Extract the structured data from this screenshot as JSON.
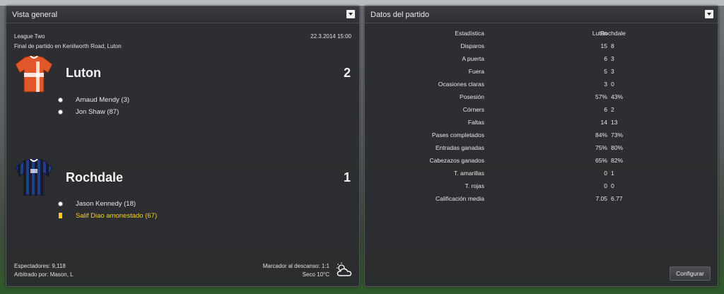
{
  "overview": {
    "title": "Vista general",
    "competition": "League Two",
    "datetime": "22.3.2014 15:00",
    "venue": "Final de partido en Kenilworth Road, Luton",
    "home": {
      "name": "Luton",
      "score": "2",
      "events": [
        {
          "type": "goal",
          "text": "Arnaud Mendy (3)"
        },
        {
          "type": "goal",
          "text": "Jon Shaw (87)"
        }
      ]
    },
    "away": {
      "name": "Rochdale",
      "score": "1",
      "events": [
        {
          "type": "goal",
          "text": "Jason Kennedy (18)"
        },
        {
          "type": "yellow-card",
          "text": "Salif Diao amonestado (67)"
        }
      ]
    },
    "attendance": "Espectadores: 9,118",
    "referee": "Arbitrado por: Mason, L",
    "halftime": "Marcador al descanso: 1:1",
    "weather": "Seco 10°C"
  },
  "stats": {
    "title": "Datos del partido",
    "header": {
      "label": "Estadística",
      "home": "Luton",
      "away": "Rochdale"
    },
    "rows": [
      {
        "label": "Disparos",
        "home": "15",
        "away": "8"
      },
      {
        "label": "A puerta",
        "home": "6",
        "away": "3"
      },
      {
        "label": "Fuera",
        "home": "5",
        "away": "3"
      },
      {
        "label": "Ocasiones claras",
        "home": "3",
        "away": "0"
      },
      {
        "label": "Posesión",
        "home": "57%",
        "away": "43%"
      },
      {
        "label": "Córners",
        "home": "6",
        "away": "2"
      },
      {
        "label": "Faltas",
        "home": "14",
        "away": "13"
      },
      {
        "label": "Pases completados",
        "home": "84%",
        "away": "73%"
      },
      {
        "label": "Entradas ganadas",
        "home": "75%",
        "away": "80%"
      },
      {
        "label": "Cabezazos ganados",
        "home": "65%",
        "away": "82%"
      },
      {
        "label": "T. amarillas",
        "home": "0",
        "away": "1"
      },
      {
        "label": "T. rojas",
        "home": "0",
        "away": "0"
      },
      {
        "label": "Calificación media",
        "home": "7.05",
        "away": "6.77"
      }
    ],
    "configure_label": "Configurar"
  },
  "colors": {
    "luton_orange": "#e0572a",
    "rochdale_blue": "#1f3e8c",
    "yellow_card": "#f2cf12"
  }
}
